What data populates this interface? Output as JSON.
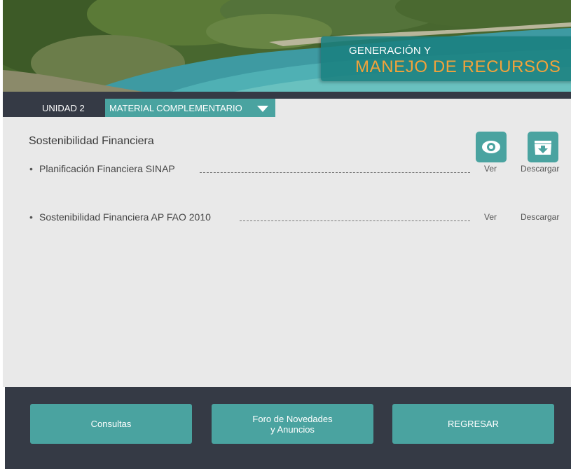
{
  "header": {
    "title_line1": "GENERACIÓN Y",
    "title_line2": "MANEJO DE RECURSOS"
  },
  "nav": {
    "unit": "UNIDAD 2",
    "material": "MATERIAL COMPLEMENTARIO"
  },
  "content": {
    "section_title": "Sostenibilidad Financiera",
    "items": [
      {
        "bullet": "•",
        "label": "Planificación Financiera SINAP",
        "view": "Ver",
        "download": "Descargar"
      },
      {
        "bullet": "•",
        "label": "Sostenibilidad Financiera AP FAO 2010",
        "view": "Ver",
        "download": "Descargar"
      }
    ]
  },
  "footer": {
    "button1": "Consultas",
    "button2_line1": "Foro de Novedades",
    "button2_line2": "y Anuncios",
    "button3": "REGRESAR"
  },
  "colors": {
    "teal": "#4aa3a0",
    "dark": "#353a45",
    "orange_title": "#f3a23a"
  }
}
